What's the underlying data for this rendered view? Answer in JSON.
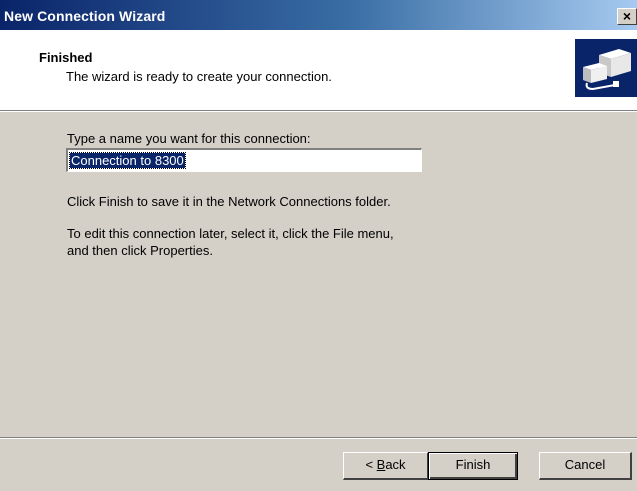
{
  "window": {
    "title": "New Connection Wizard",
    "close_glyph": "×"
  },
  "header": {
    "title": "Finished",
    "subtitle": "The wizard is ready to create your connection.",
    "icon": "network-connection-icon"
  },
  "body": {
    "name_label": "Type a name you want for this connection:",
    "name_value": "Connection to 8300",
    "hint_save": "Click Finish to save it in the Network Connections folder.",
    "hint_edit_line1": "To edit this connection later, select it, click the File menu,",
    "hint_edit_line2": "and then click Properties."
  },
  "buttons": {
    "back_prefix": "< ",
    "back_mnemonic": "B",
    "back_rest": "ack",
    "finish": "Finish",
    "cancel": "Cancel"
  },
  "colors": {
    "title_gradient_start": "#0a246a",
    "title_gradient_end": "#a6caf0",
    "dialog_face": "#d4d0c8",
    "selection": "#0a246a"
  }
}
